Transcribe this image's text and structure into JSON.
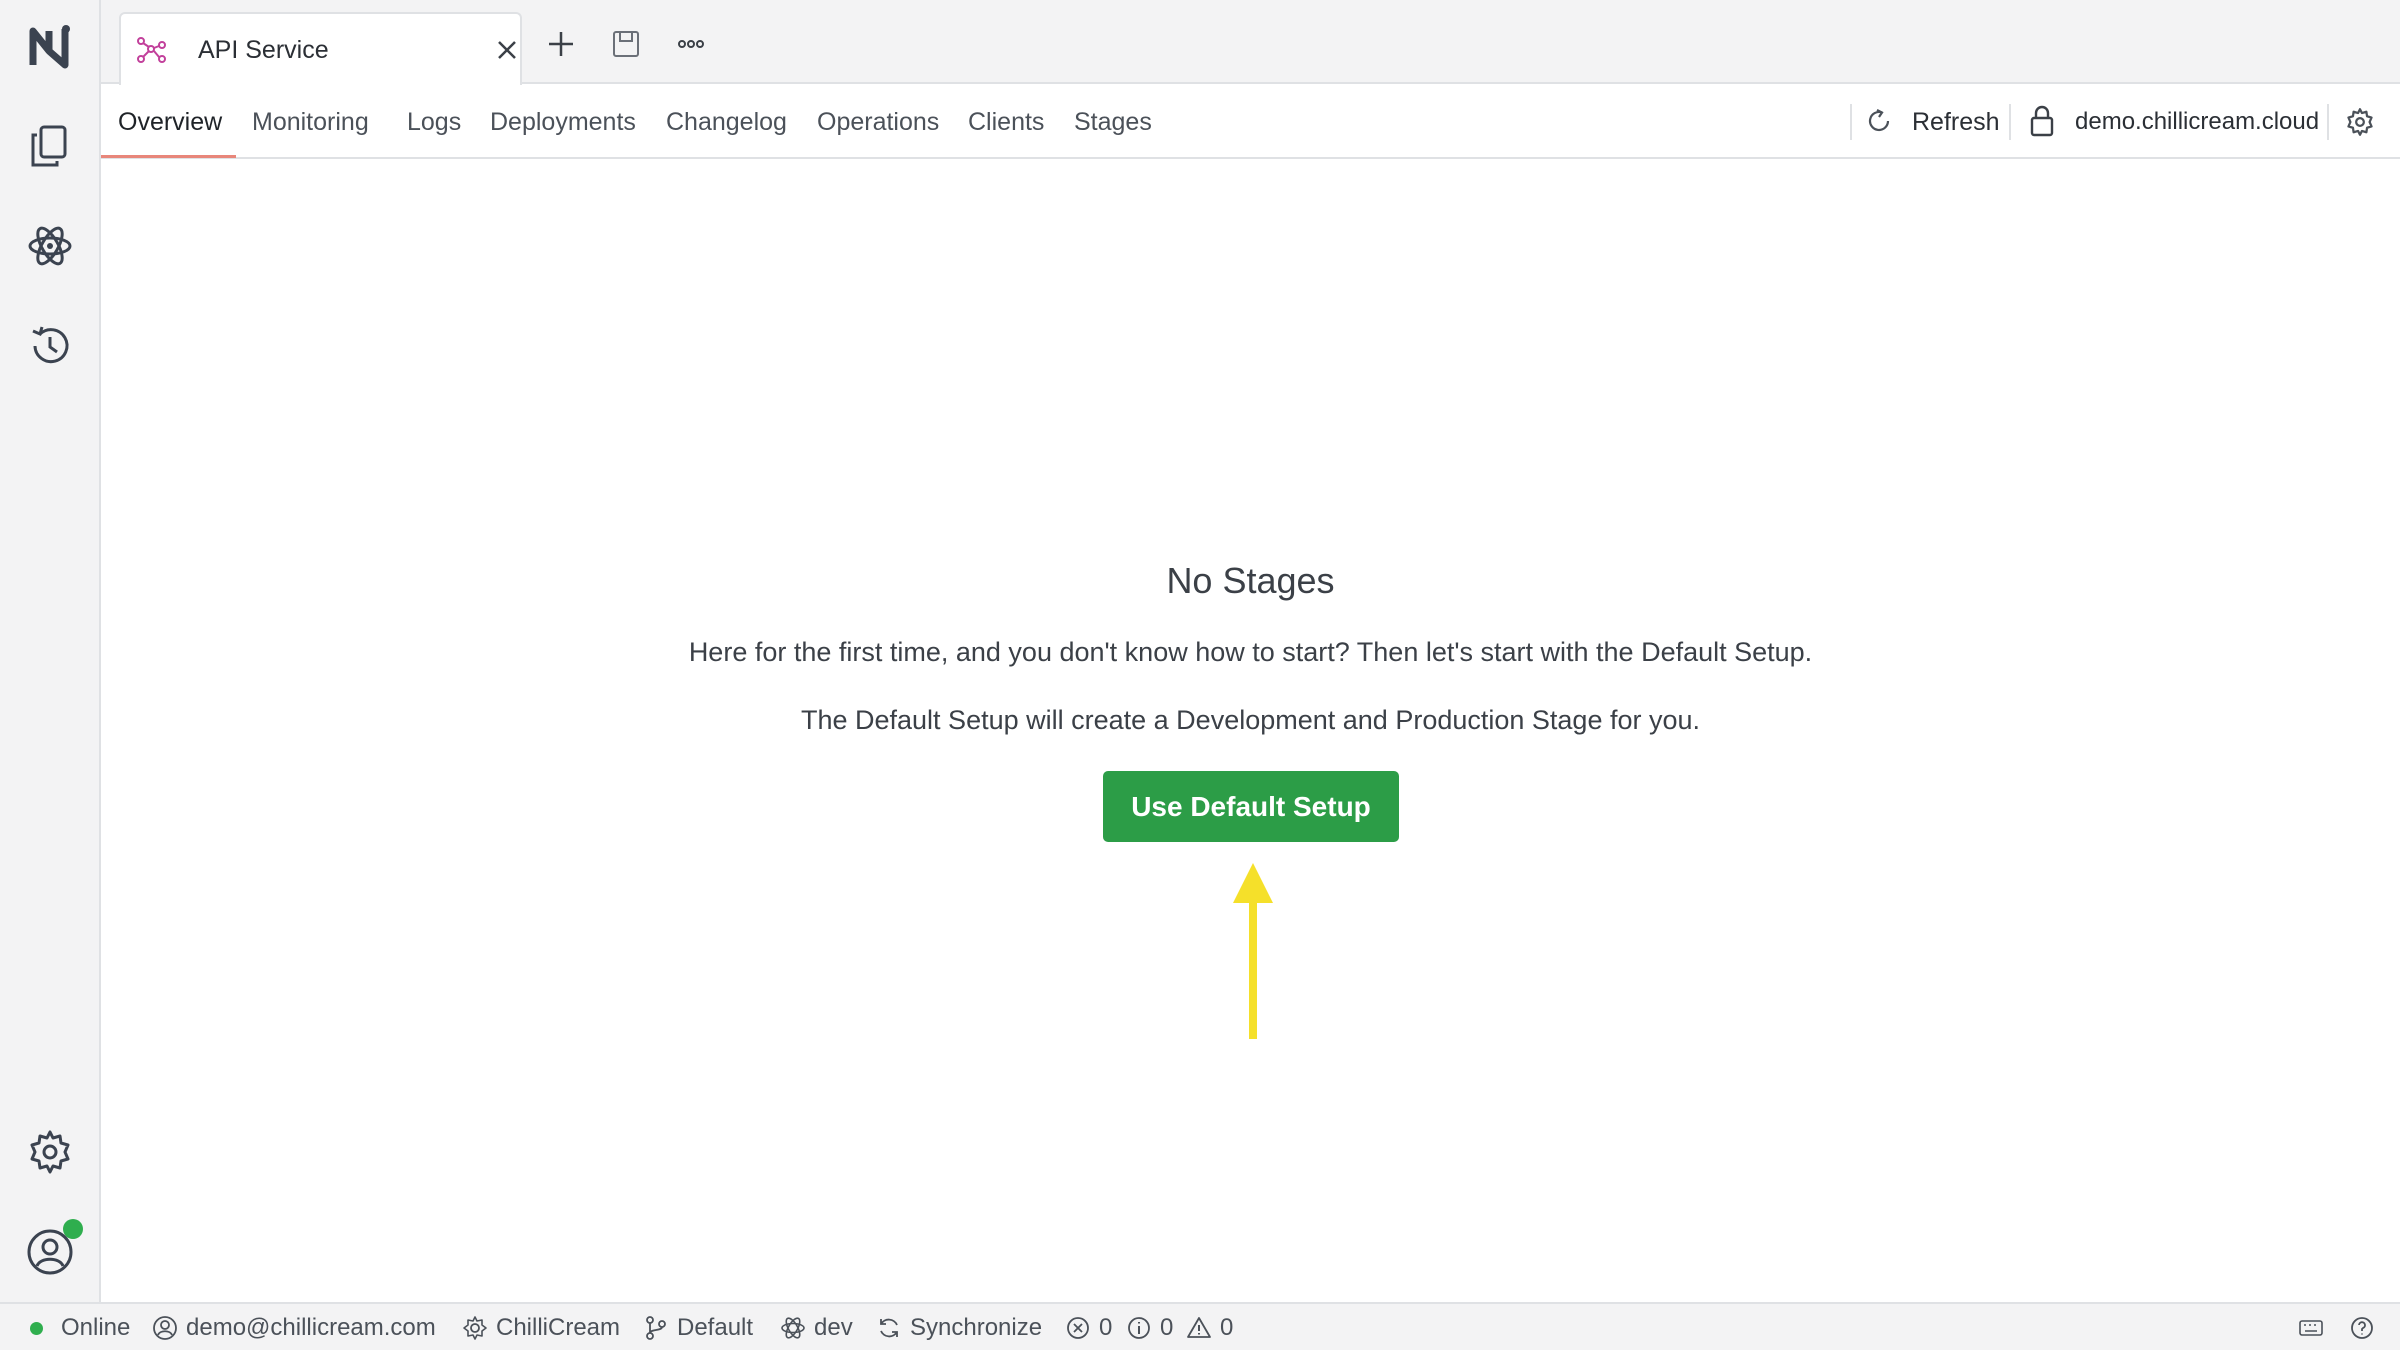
{
  "document_tab": {
    "title": "API Service",
    "icon": "api-service-icon"
  },
  "subnav": {
    "tabs": [
      {
        "label": "Overview",
        "active": true
      },
      {
        "label": "Monitoring"
      },
      {
        "label": "Logs"
      },
      {
        "label": "Deployments"
      },
      {
        "label": "Changelog"
      },
      {
        "label": "Operations"
      },
      {
        "label": "Clients"
      },
      {
        "label": "Stages"
      }
    ],
    "refresh_label": "Refresh",
    "endpoint": "demo.chillicream.cloud"
  },
  "empty_state": {
    "title": "No Stages",
    "line1": "Here for the first time, and you don't know how to start? Then let's start with the Default Setup.",
    "line2": "The Default Setup will create a Development and Production Stage for you.",
    "button_label": "Use Default Setup"
  },
  "statusbar": {
    "online": "Online",
    "user": "demo@chillicream.com",
    "workspace": "ChilliCream",
    "branch": "Default",
    "stage": "dev",
    "sync": "Synchronize",
    "errors": "0",
    "infos": "0",
    "warnings": "0"
  },
  "colors": {
    "accent_underline": "#e8867a",
    "primary_button": "#2c9d47",
    "annotation_arrow": "#f5e02a",
    "online_indicator": "#2fae4e"
  }
}
